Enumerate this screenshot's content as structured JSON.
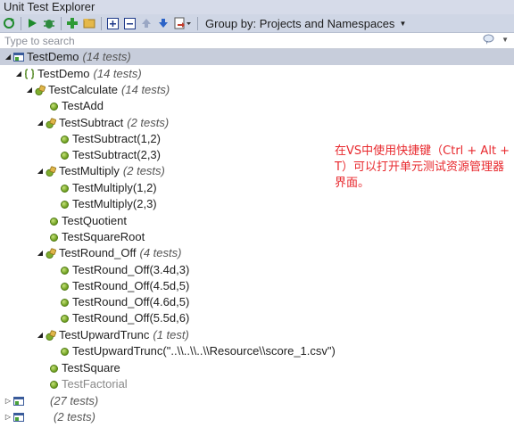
{
  "window": {
    "title": "Unit Test Explorer"
  },
  "toolbar": {
    "group_by_label": "Group by: Projects and Namespaces"
  },
  "search": {
    "placeholder": "Type to search",
    "value": ""
  },
  "tree": {
    "root": {
      "label": "TestDemo",
      "count": "(14 tests)"
    },
    "namespace": {
      "label": "TestDemo",
      "count": "(14 tests)"
    },
    "calc": {
      "label": "TestCalculate",
      "count": "(14 tests)"
    },
    "test_add": "TestAdd",
    "subtract": {
      "label": "TestSubtract",
      "count": "(2 tests)"
    },
    "subtract_1": "TestSubtract(1,2)",
    "subtract_2": "TestSubtract(2,3)",
    "multiply": {
      "label": "TestMultiply",
      "count": "(2 tests)"
    },
    "multiply_1": "TestMultiply(1,2)",
    "multiply_2": "TestMultiply(2,3)",
    "test_quotient": "TestQuotient",
    "test_squareroot": "TestSquareRoot",
    "round": {
      "label": "TestRound_Off",
      "count": "(4 tests)"
    },
    "round_1": "TestRound_Off(3.4d,3)",
    "round_2": "TestRound_Off(4.5d,5)",
    "round_3": "TestRound_Off(4.6d,5)",
    "round_4": "TestRound_Off(5.5d,6)",
    "upward": {
      "label": "TestUpwardTrunc",
      "count": "(1 test)"
    },
    "upward_1": "TestUpwardTrunc(\"..\\\\..\\\\..\\\\Resource\\\\score_1.csv\")",
    "test_square": "TestSquare",
    "test_factorial": "TestFactorial",
    "project2": {
      "count": "(27 tests)"
    },
    "project3": {
      "count": "(2 tests)"
    }
  },
  "annotation": {
    "text": "在VS中使用快捷键（Ctrl + Alt + T）可以打开单元测试资源管理器界面。"
  },
  "colors": {
    "accent_red": "#e8282d",
    "pass_green": "#6c9e1d",
    "selected_row": "#c7cddb"
  }
}
